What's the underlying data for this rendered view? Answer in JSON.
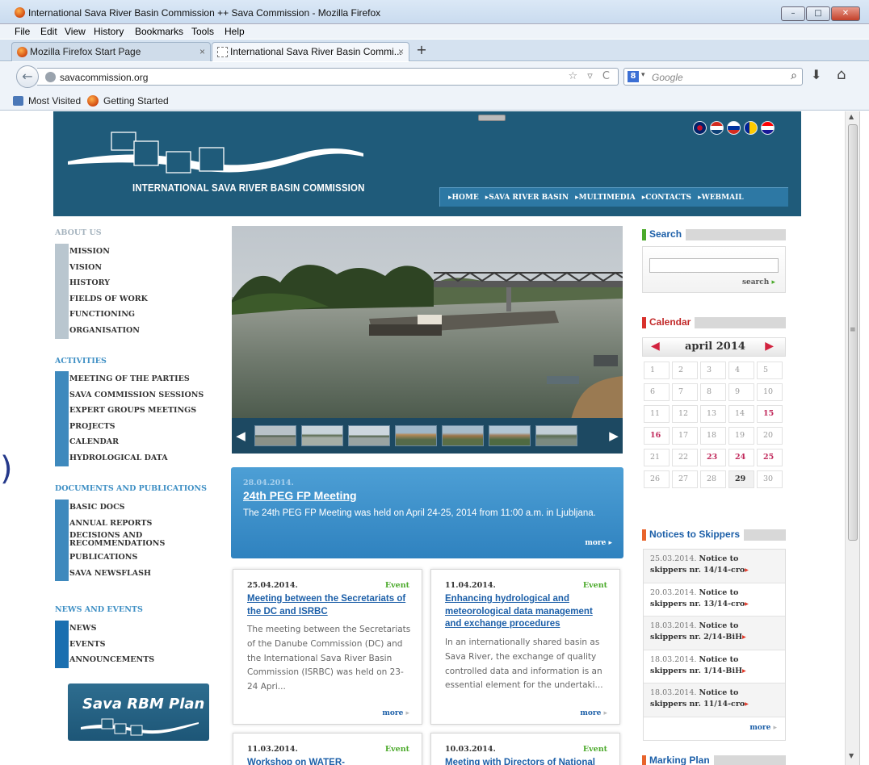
{
  "window": {
    "title": "International Sava River Basin Commission ++ Sava Commission - Mozilla Firefox",
    "min": "–",
    "max": "□",
    "close": "✕"
  },
  "menu": [
    "File",
    "Edit",
    "View",
    "History",
    "Bookmarks",
    "Tools",
    "Help"
  ],
  "tabs": [
    {
      "label": "Mozilla Firefox Start Page",
      "close": "×"
    },
    {
      "label": "International Sava River Basin Commi...",
      "close": "×"
    }
  ],
  "new_tab": "+",
  "nav": {
    "url": "savacommission.org",
    "url_icons": "☆ ▿ C",
    "search_engine": "8",
    "search_placeholder": "Google"
  },
  "bookmarks": [
    "Most Visited",
    "Getting Started"
  ],
  "site": {
    "title": "INTERNATIONAL SAVA RIVER BASIN COMMISSION",
    "topnav": [
      "▸HOME",
      "▸SAVA RIVER BASIN",
      "▸MULTIMEDIA",
      "▸CONTACTS",
      "▸WEBMAIL"
    ]
  },
  "sidebar": {
    "about_title": "ABOUT US",
    "about": [
      "MISSION",
      "VISION",
      "HISTORY",
      "FIELDS OF WORK",
      "FUNCTIONING",
      "ORGANISATION"
    ],
    "activities_title": "ACTIVITIES",
    "activities": [
      "MEETING OF THE PARTIES",
      "SAVA COMMISSION SESSIONS",
      "EXPERT GROUPS MEETINGS",
      "PROJECTS",
      "CALENDAR",
      "HYDROLOGICAL DATA"
    ],
    "docs_title": "DOCUMENTS AND PUBLICATIONS",
    "docs": [
      "BASIC DOCS",
      "ANNUAL REPORTS",
      "DECISIONS AND",
      "RECOMMENDATIONS",
      "PUBLICATIONS",
      "SAVA NEWSFLASH"
    ],
    "news_title": "NEWS AND EVENTS",
    "news": [
      "NEWS",
      "EVENTS",
      "ANNOUNCEMENTS"
    ],
    "rbm_banner": "Sava RBM Plan"
  },
  "feature": {
    "date": "28.04.2014.",
    "title": "24th PEG FP Meeting",
    "body": "The 24th PEG FP Meeting was held on April 24-25, 2014 from 11:00 a.m. in Ljubljana.",
    "more": "more ▸"
  },
  "cards": [
    {
      "date": "25.04.2014.",
      "tag": "Event",
      "title": "Meeting between the Secretariats of the DC and ISRBC",
      "body": "The meeting between the Secretariats of the Danube Commission (DC) and the International Sava River Basin Commission (ISRBC) was held on 23-24 Apri...",
      "more": "more"
    },
    {
      "date": "11.04.2014.",
      "tag": "Event",
      "title": "Enhancing hydrological and meteorological data management and exchange procedures",
      "body": "In an internationally shared basin as Sava River, the exchange of quality controlled data and information is an essential element for the undertaki...",
      "more": "more"
    },
    {
      "date": "11.03.2014.",
      "tag": "Event",
      "title": "Workshop on WATER-",
      "body": "",
      "more": ""
    },
    {
      "date": "10.03.2014.",
      "tag": "Event",
      "title": "Meeting with Directors of National",
      "body": "",
      "more": ""
    }
  ],
  "right": {
    "search_title": "Search",
    "search_button": "search",
    "search_arrow": "▸",
    "calendar_title": "Calendar",
    "month": "april 2014",
    "cal_prev": "◀",
    "cal_next": "▶",
    "days": [
      "1",
      "2",
      "3",
      "4",
      "5",
      "6",
      "7",
      "8",
      "9",
      "10",
      "11",
      "12",
      "13",
      "14",
      "15",
      "16",
      "17",
      "18",
      "19",
      "20",
      "21",
      "22",
      "23",
      "24",
      "25",
      "26",
      "27",
      "28",
      "29",
      "30"
    ],
    "highlighted_days": [
      "15",
      "16",
      "23",
      "24",
      "25"
    ],
    "today": "29",
    "notices_title": "Notices to Skippers",
    "notices": [
      {
        "date": "25.03.2014.",
        "text1": "Notice to",
        "text2": "skippers nr. 14/14-cro"
      },
      {
        "date": "20.03.2014.",
        "text1": "Notice to",
        "text2": "skippers nr. 13/14-cro"
      },
      {
        "date": "18.03.2014.",
        "text1": "Notice to",
        "text2": "skippers nr. 2/14-BiH"
      },
      {
        "date": "18.03.2014.",
        "text1": "Notice to",
        "text2": "skippers nr. 1/14-BiH"
      },
      {
        "date": "18.03.2014.",
        "text1": "Notice to",
        "text2": "skippers nr. 11/14-cro"
      }
    ],
    "notices_more": "more",
    "marking_title": "Marking Plan"
  },
  "colors": {
    "header": "#1f5b7a",
    "accent_blue": "#1c5fa8",
    "event_green": "#4caa2c",
    "highlight": "#c12a5c"
  }
}
